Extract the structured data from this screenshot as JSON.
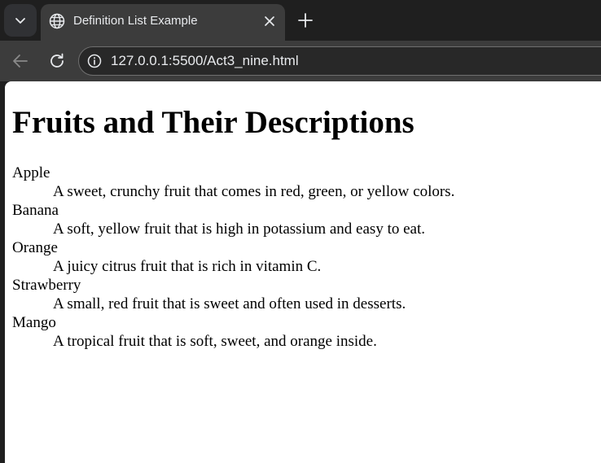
{
  "tab": {
    "title": "Definition List Example",
    "favicon": "globe-icon",
    "close_icon": "close-icon"
  },
  "toolbar": {
    "url": "127.0.0.1:5500/Act3_nine.html",
    "back_icon": "back-arrow-icon",
    "reload_icon": "reload-icon",
    "info_icon": "info-icon",
    "new_tab_icon": "plus-icon",
    "tab_search_icon": "chevron-down-icon"
  },
  "page": {
    "heading": "Fruits and Their Descriptions",
    "items": [
      {
        "term": "Apple",
        "description": "A sweet, crunchy fruit that comes in red, green, or yellow colors."
      },
      {
        "term": "Banana",
        "description": "A soft, yellow fruit that is high in potassium and easy to eat."
      },
      {
        "term": "Orange",
        "description": "A juicy citrus fruit that is rich in vitamin C."
      },
      {
        "term": "Strawberry",
        "description": "A small, red fruit that is sweet and often used in desserts."
      },
      {
        "term": "Mango",
        "description": "A tropical fruit that is soft, sweet, and orange inside."
      }
    ]
  },
  "colors": {
    "tabstrip": "#1f1f1f",
    "active_tab": "#3c3c3c",
    "omnibox": "#282828",
    "page_bg": "#ffffff",
    "text": "#000000"
  }
}
